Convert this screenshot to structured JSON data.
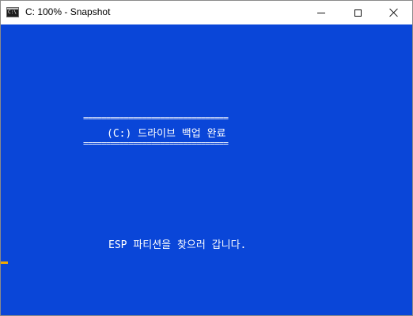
{
  "window": {
    "title": "C: 100% - Snapshot",
    "icon": "console-icon",
    "controls": {
      "minimize": "minimize-icon",
      "maximize": "maximize-icon",
      "close": "close-icon"
    }
  },
  "console": {
    "background_color": "#0a46d8",
    "text_color": "#ffffff",
    "cursor_color": "#f2a900",
    "banner_rule": "================================",
    "banner_text": "(C:) 드라이브 백업 완료",
    "status_text": "ESP 파티션을 찾으러 갑니다."
  }
}
